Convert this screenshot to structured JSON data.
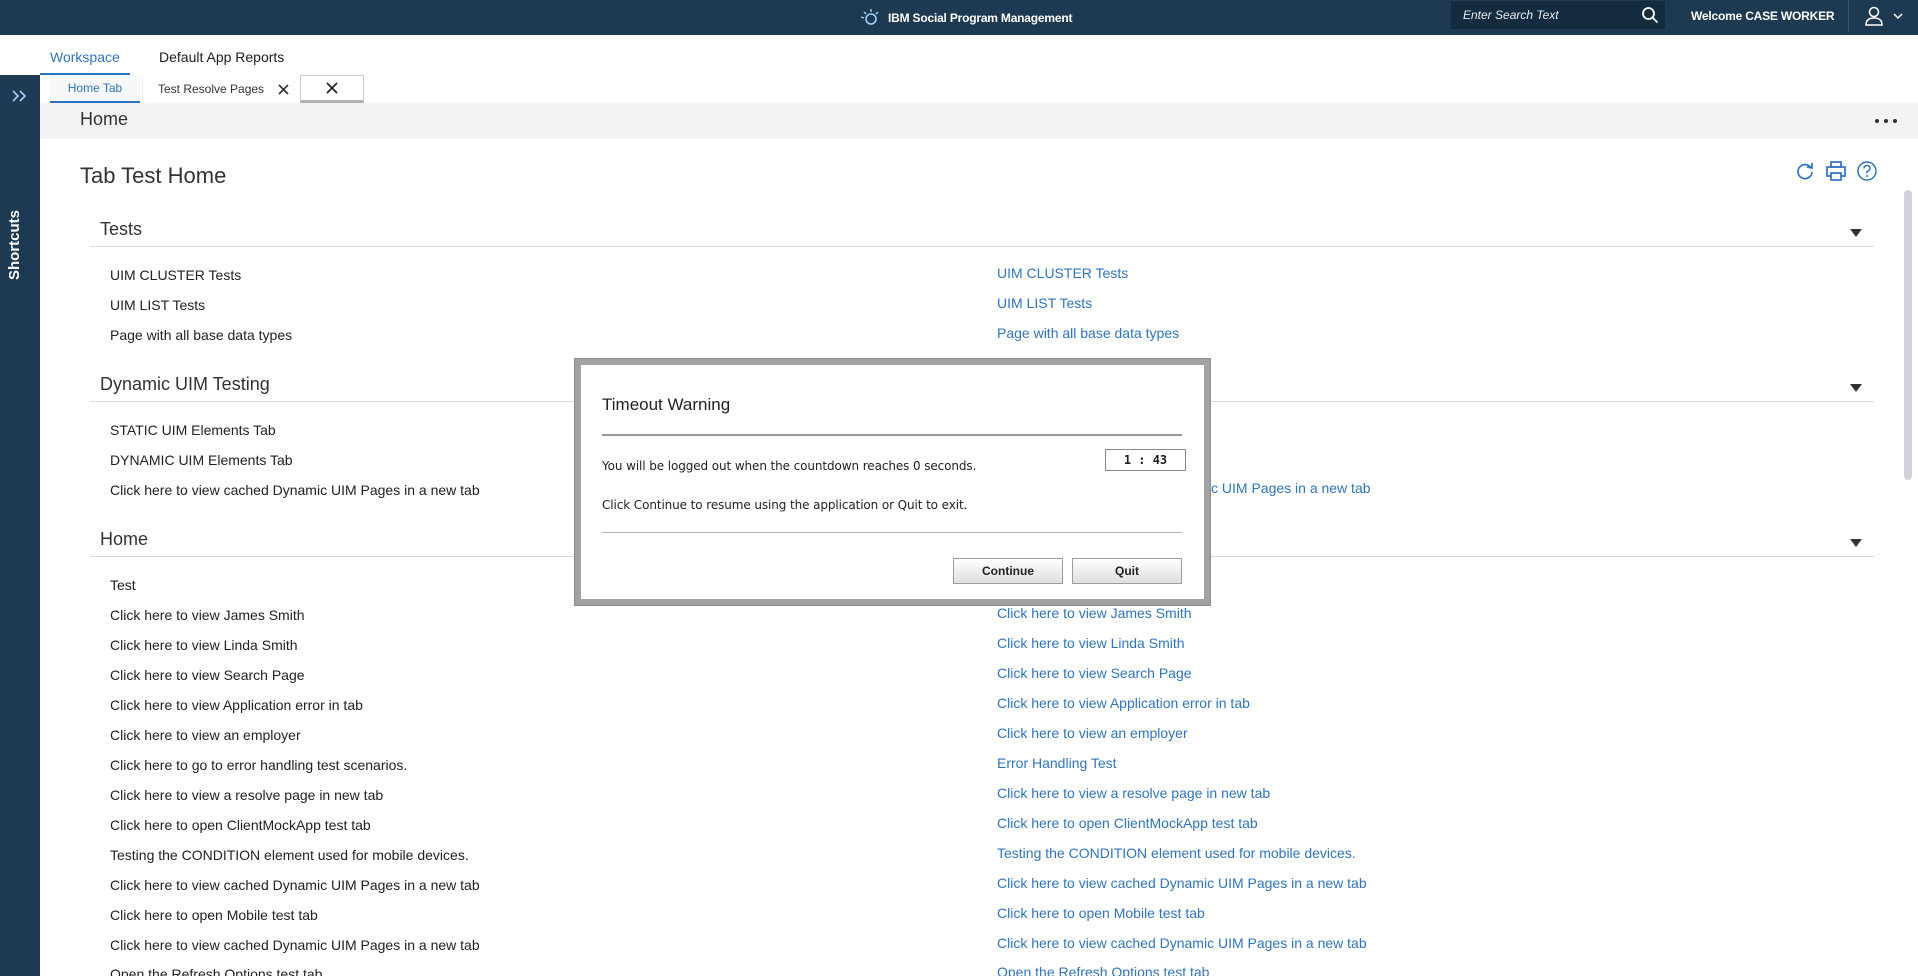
{
  "topbar": {
    "brand": "IBM Social Program Management",
    "search_placeholder": "Enter Search Text",
    "welcome": "Welcome CASE WORKER"
  },
  "nav": {
    "tabs": [
      {
        "label": "Workspace",
        "active": true
      },
      {
        "label": "Default App Reports",
        "active": false
      }
    ]
  },
  "sidebar": {
    "label": "Shortcuts"
  },
  "subtabs": {
    "home": "Home Tab",
    "resolve": "Test Resolve Pages"
  },
  "header": {
    "title": "Home"
  },
  "page": {
    "title": "Tab Test Home"
  },
  "sections": {
    "tests": {
      "title": "Tests",
      "labels": [
        "UIM CLUSTER Tests",
        "UIM LIST Tests",
        "Page with all base data types"
      ],
      "links": [
        "UIM CLUSTER Tests",
        "UIM LIST Tests",
        "Page with all base data types"
      ]
    },
    "dynamic": {
      "title": "Dynamic UIM Testing",
      "labels": [
        "STATIC UIM Elements Tab",
        "DYNAMIC UIM Elements Tab",
        "Click here to view cached Dynamic UIM Pages in a new tab"
      ],
      "link_partial": "c UIM Pages in a new tab"
    },
    "home": {
      "title": "Home",
      "labels": [
        "Test",
        "Click here to view James Smith",
        "Click here to view Linda Smith",
        "Click here to view Search Page",
        "Click here to view Application error in tab",
        "Click here to view an employer",
        "Click here to go to error handling test scenarios.",
        "Click here to view a resolve page in new tab",
        "Click here to open ClientMockApp test tab",
        "Testing the CONDITION element used for mobile devices.",
        "Click here to view cached Dynamic UIM Pages in a new tab",
        "Click here to open Mobile test tab",
        "Click here to view cached Dynamic UIM Pages in a new tab",
        "Open the Refresh Options test tab"
      ],
      "links": [
        "Click here to view James Smith",
        "Click here to view Linda Smith",
        "Click here to view Search Page",
        "Click here to view Application error in tab",
        "Click here to view an employer",
        "Error Handling Test",
        "Click here to view a resolve page in new tab",
        "Click here to open ClientMockApp test tab",
        "Testing the CONDITION element used for mobile devices.",
        "Click here to view cached Dynamic UIM Pages in a new tab",
        "Click here to open Mobile test tab",
        "Click here to view cached Dynamic UIM Pages in a new tab",
        "Open the Refresh Options test tab"
      ]
    }
  },
  "modal": {
    "title": "Timeout Warning",
    "message": "You will be logged out when the countdown reaches 0 seconds.",
    "countdown": "1 : 43",
    "instruction": "Click Continue to resume using the application or Quit to exit.",
    "continue_label": "Continue",
    "quit_label": "Quit"
  },
  "colors": {
    "topbar": "#1e3a52",
    "link": "#2f74c0",
    "header_band": "#f3f3f3",
    "modal_frame": "#a2a2a2"
  }
}
